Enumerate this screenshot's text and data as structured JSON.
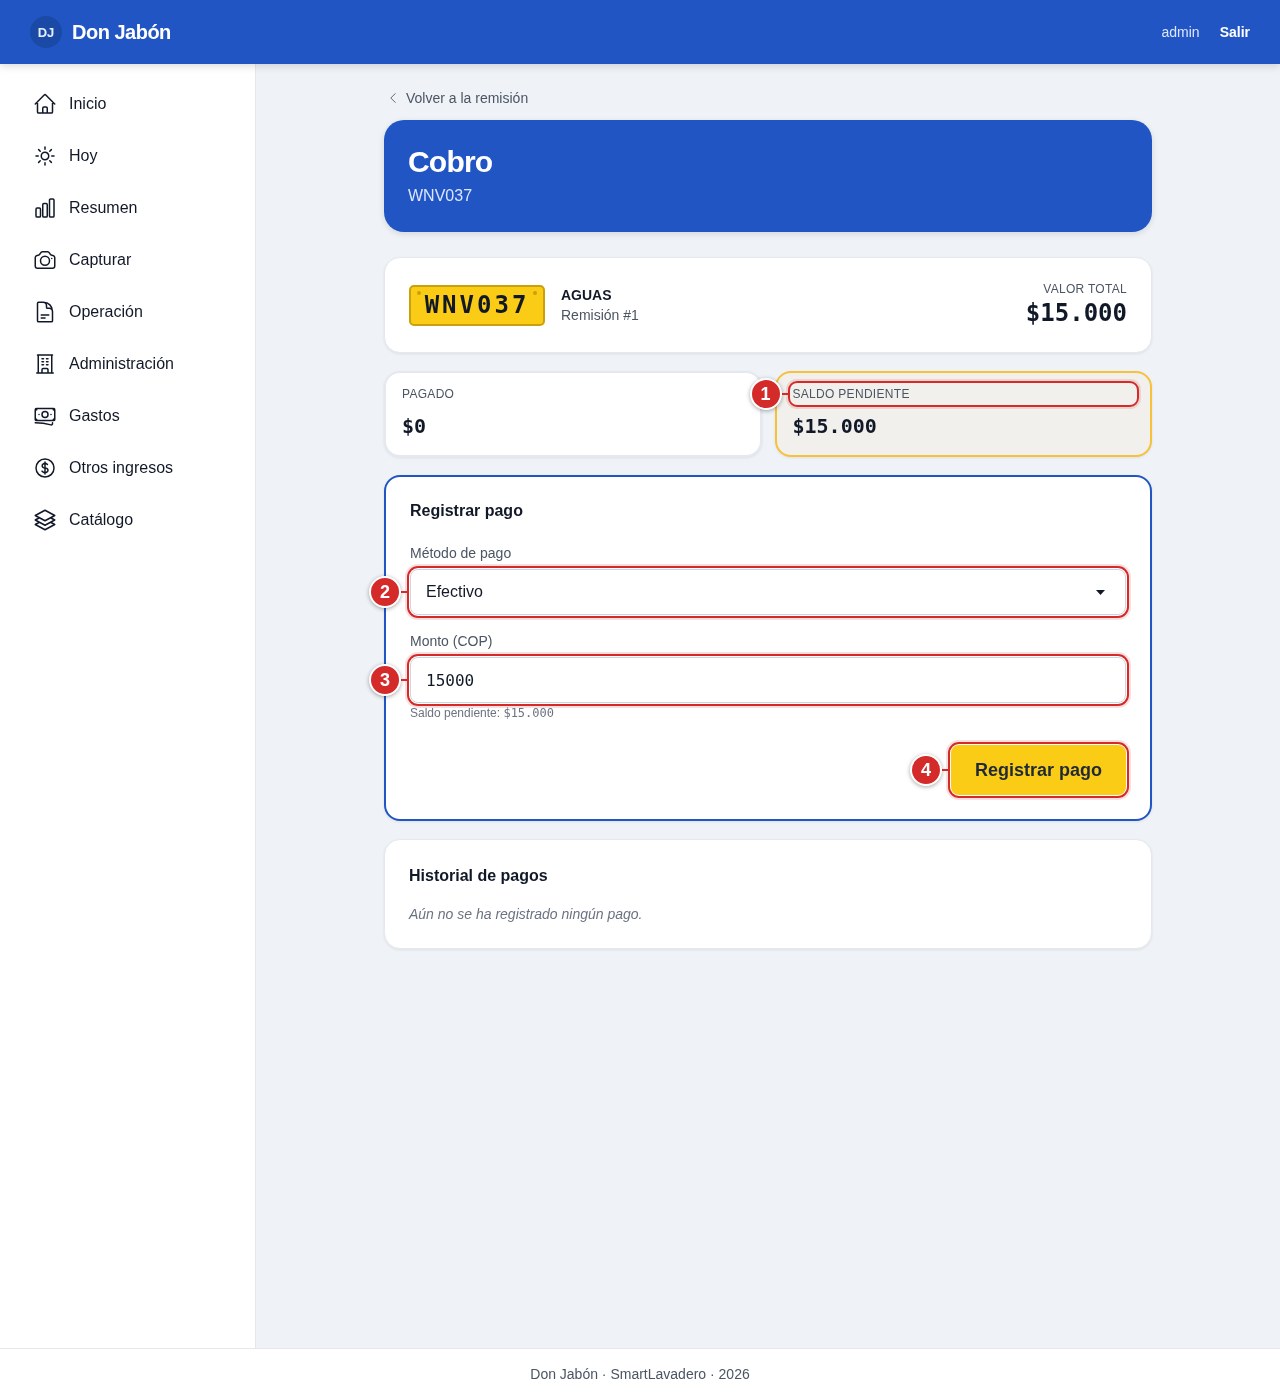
{
  "header": {
    "logo_letters": "DJ",
    "brand": "Don Jabón",
    "user": "admin",
    "logout": "Salir"
  },
  "sidebar": {
    "items": [
      {
        "label": "Inicio"
      },
      {
        "label": "Hoy"
      },
      {
        "label": "Resumen"
      },
      {
        "label": "Capturar"
      },
      {
        "label": "Operación"
      },
      {
        "label": "Administración"
      },
      {
        "label": "Gastos"
      },
      {
        "label": "Otros ingresos"
      },
      {
        "label": "Catálogo"
      }
    ]
  },
  "back_link": "Volver a la remisión",
  "hero": {
    "title": "Cobro",
    "subtitle": "WNV037"
  },
  "vehicle": {
    "plate": "WNV037",
    "client": "AGUAS",
    "reference": "Remisión #1",
    "total_label": "VALOR TOTAL",
    "total_value": "$15.000"
  },
  "summary": [
    {
      "label": "PAGADO",
      "value": "$0",
      "emphasized": false
    },
    {
      "label": "SALDO PENDIENTE",
      "value": "$15.000",
      "emphasized": true,
      "label_marker": "1"
    }
  ],
  "payment_form": {
    "title": "Registrar pago",
    "method": {
      "label": "Método de pago",
      "value": "Efectivo",
      "marker": "2"
    },
    "amount": {
      "label": "Monto (COP)",
      "value": "15000",
      "marker": "3",
      "helper_label": "Saldo pendiente:",
      "helper_value": "$15.000"
    },
    "submit": {
      "label": "Registrar pago",
      "marker": "4"
    }
  },
  "history": {
    "title": "Historial de pagos",
    "empty_message": "Aún no se ha registrado ningún pago."
  },
  "footer": "Don Jabón · SmartLavadero · 2026"
}
